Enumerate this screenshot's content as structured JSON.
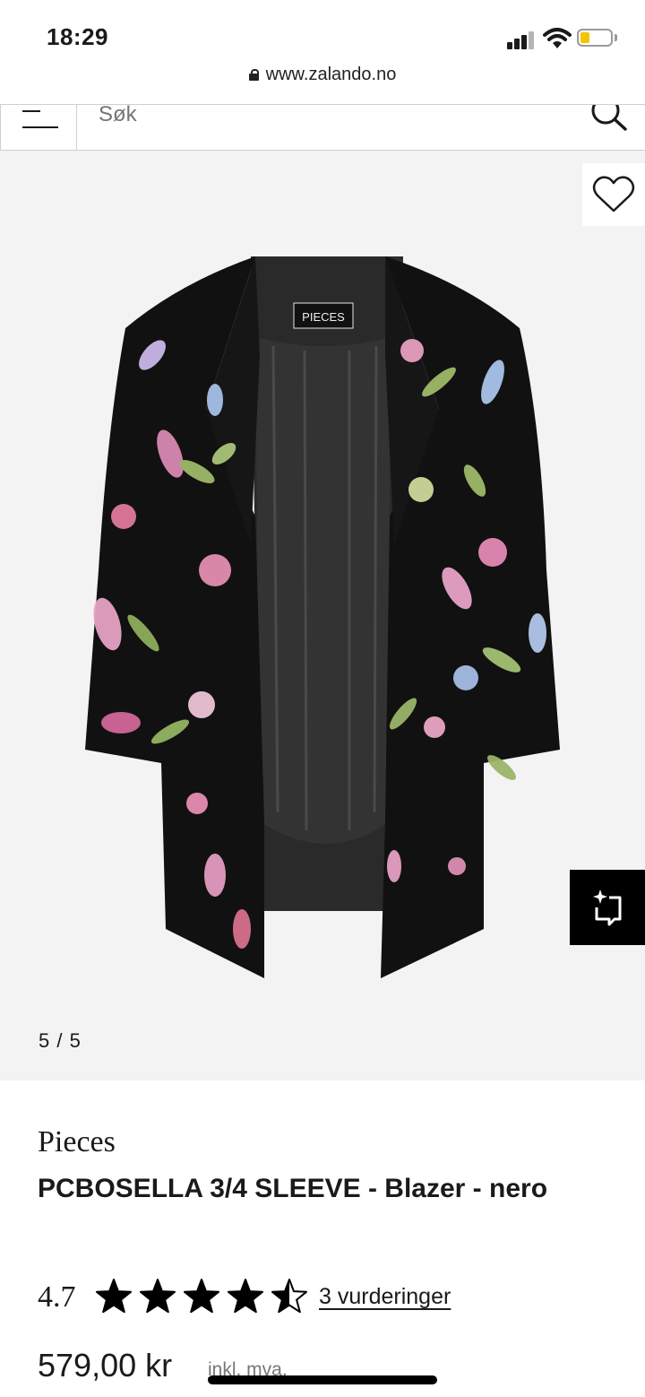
{
  "status_bar": {
    "time": "18:29"
  },
  "browser": {
    "url": "www.zalando.no"
  },
  "search": {
    "placeholder": "Søk"
  },
  "gallery": {
    "counter": "5 / 5",
    "garment_label_text": "PIECES"
  },
  "product": {
    "brand": "Pieces",
    "name": "PCBOSELLA 3/4 SLEEVE - Blazer - nero",
    "rating": "4.7",
    "rating_stars": 4.5,
    "reviews_label": "3 vurderinger",
    "price": "579,00 kr",
    "vat_note": "inkl. mva."
  },
  "colors": {
    "battery_level": "#f2c500",
    "accent": "#000000",
    "gallery_bg": "#f3f3f3"
  },
  "icons": [
    "lock-icon",
    "menu-icon",
    "search-icon",
    "heart-icon",
    "similar-items-icon",
    "star-icon"
  ]
}
